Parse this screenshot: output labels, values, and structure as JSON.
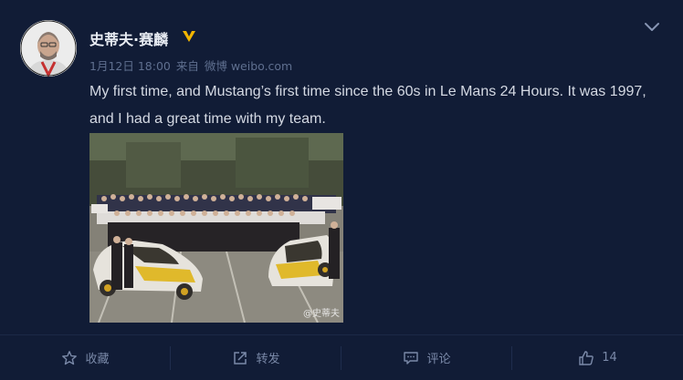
{
  "post": {
    "author_name": "史蒂夫·赛麟",
    "date": "1月12日 18:00",
    "source_prefix": "来自",
    "source": "微博 weibo.com",
    "text": "My first time, and Mustang’s first time since the 60s in Le Mans 24 Hours. It was 1997, and I had a great time with my team.",
    "image_watermark": "@史蒂夫"
  },
  "actions": [
    {
      "label": "收藏",
      "icon": "star-icon"
    },
    {
      "label": "转发",
      "icon": "repost-icon"
    },
    {
      "label": "评论",
      "icon": "comment-icon"
    },
    {
      "label": "14",
      "icon": "thumbs-up-icon"
    }
  ],
  "colors": {
    "background": "#111c36",
    "verified_badge": "#f2b500",
    "muted_text": "#5f6f8f"
  }
}
